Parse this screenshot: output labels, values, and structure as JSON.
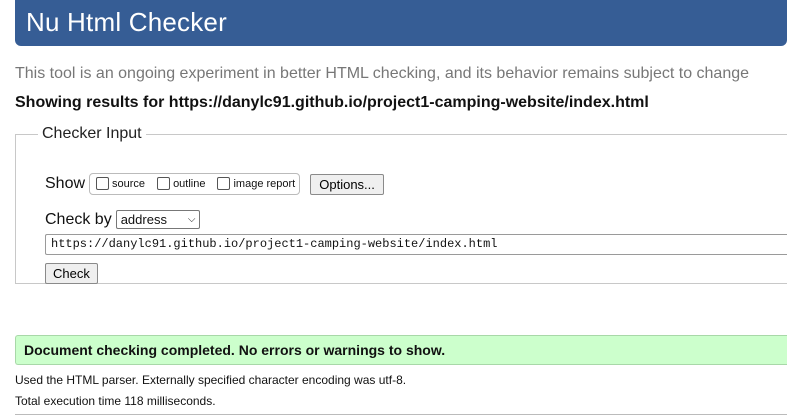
{
  "header": {
    "title": "Nu Html Checker"
  },
  "tagline": "This tool is an ongoing experiment in better HTML checking, and its behavior remains subject to change",
  "results_for": "Showing results for https://danylc91.github.io/project1-camping-website/index.html",
  "checker_input": {
    "legend": "Checker Input",
    "show_label": "Show",
    "show_options": [
      {
        "label": "source",
        "checked": false
      },
      {
        "label": "outline",
        "checked": false
      },
      {
        "label": "image report",
        "checked": false
      }
    ],
    "options_button": "Options...",
    "check_by_label": "Check by",
    "check_by_selected": "address",
    "url_value": "https://danylc91.github.io/project1-camping-website/index.html",
    "check_button": "Check"
  },
  "status": {
    "success_message": "Document checking completed. No errors or warnings to show.",
    "parser_note": "Used the HTML parser. Externally specified character encoding was utf-8.",
    "execution_time": "Total execution time 118 milliseconds."
  },
  "colors": {
    "header_bg": "#365d95",
    "success_bg": "#ccffcc"
  }
}
